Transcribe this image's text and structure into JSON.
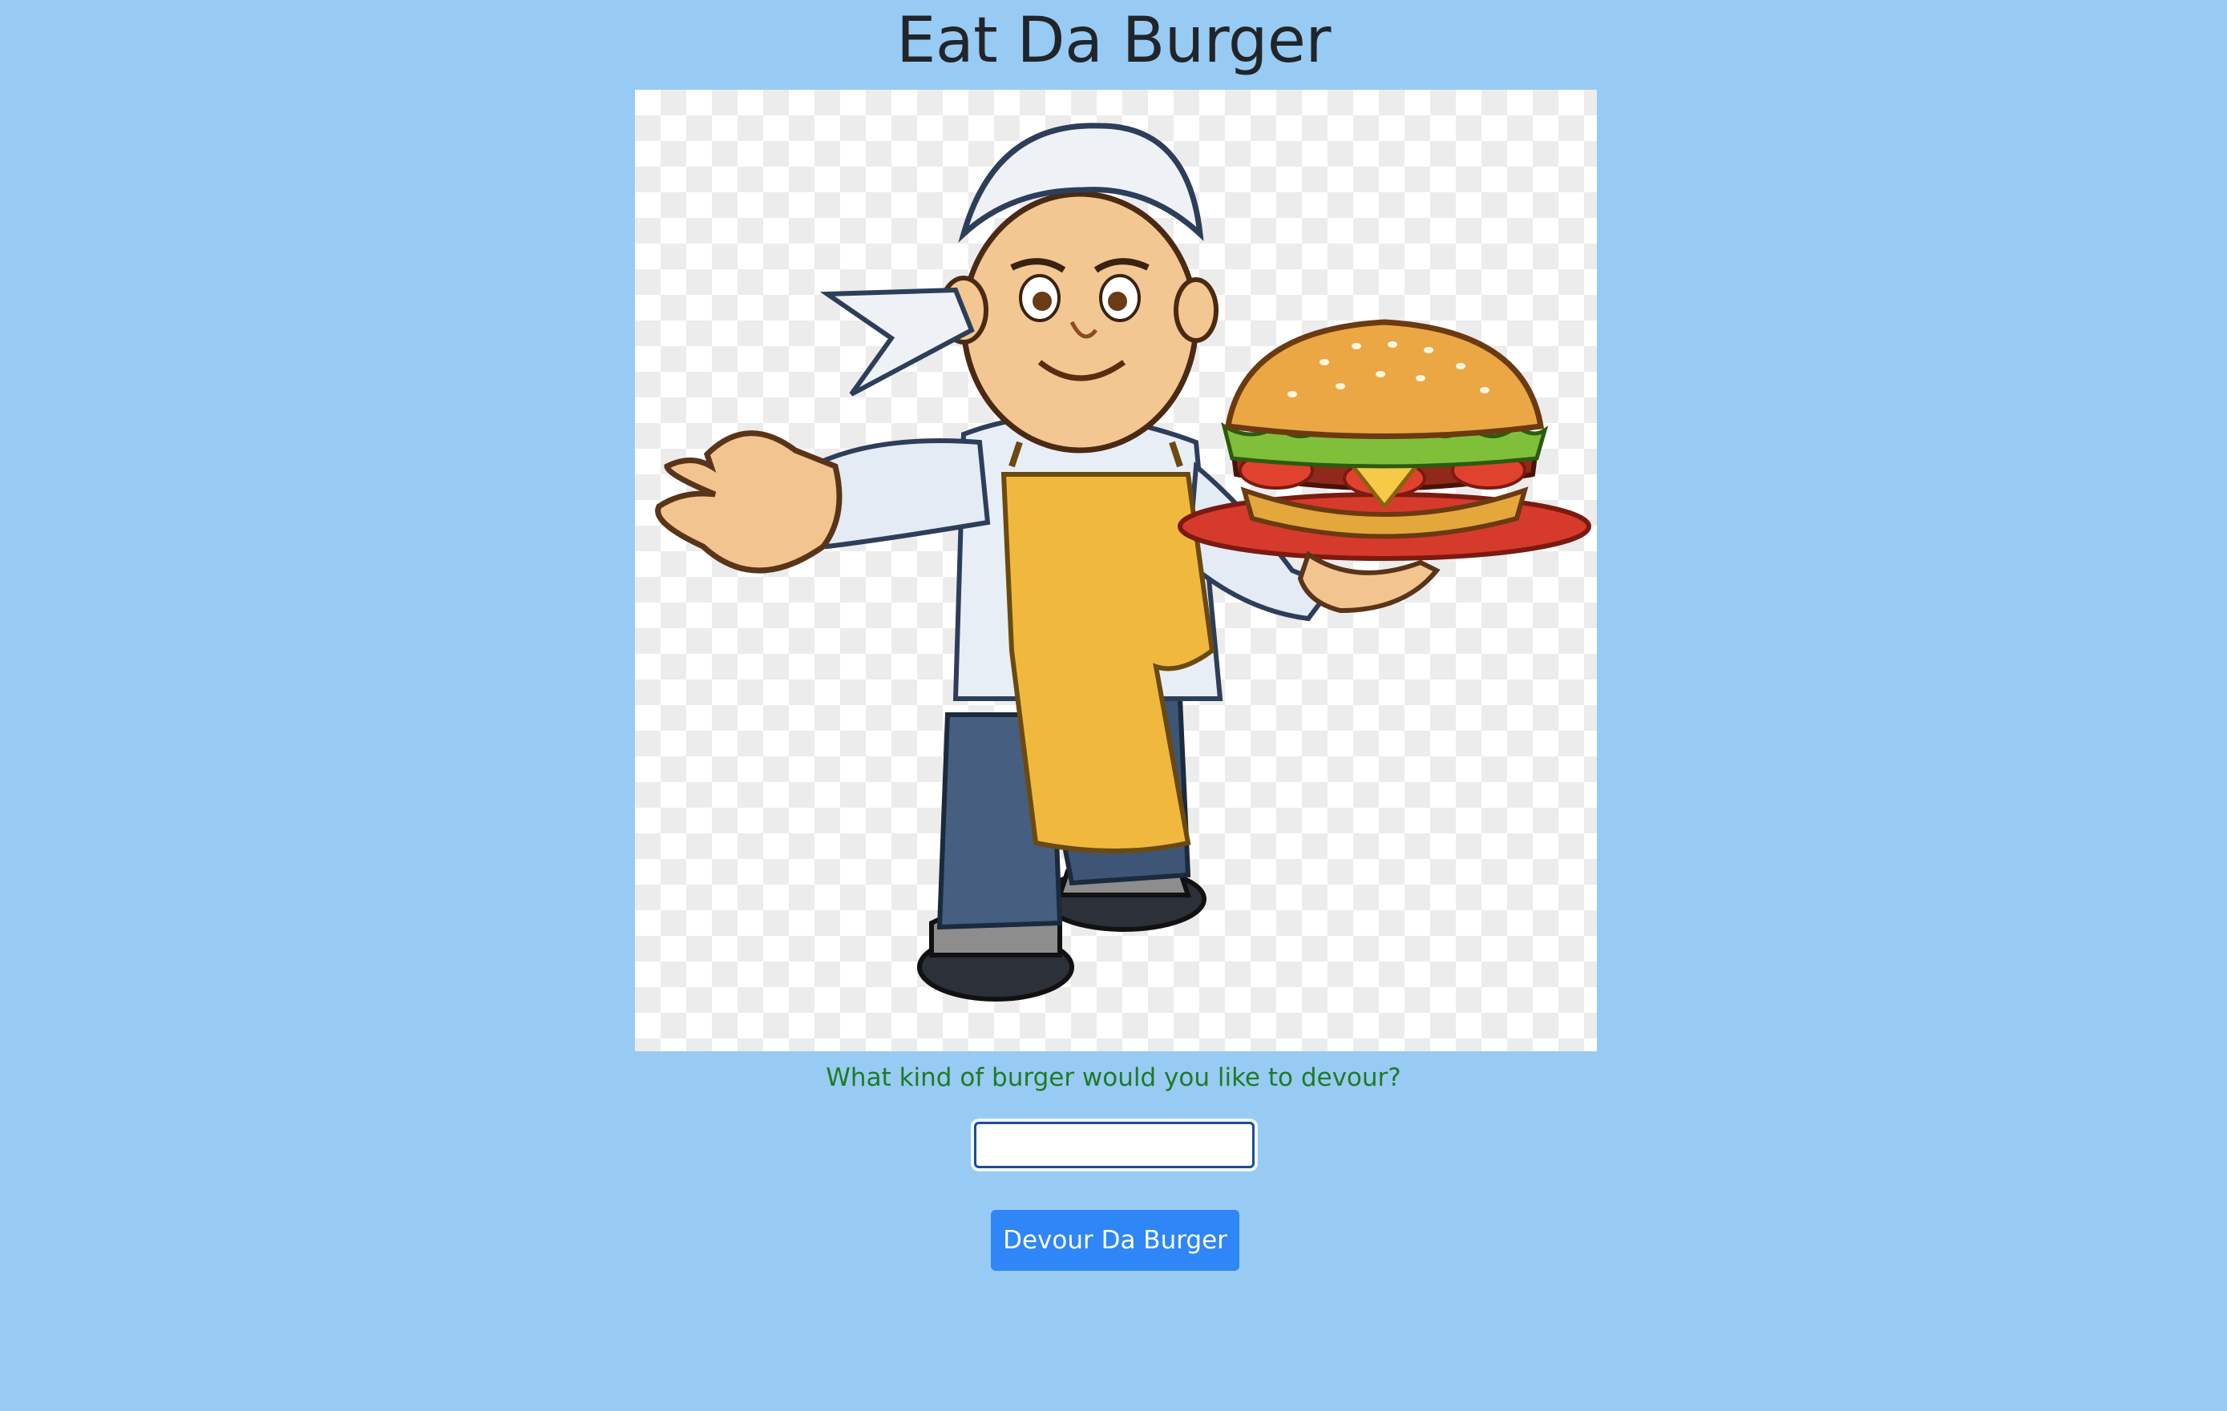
{
  "page": {
    "title": "Eat Da Burger",
    "background_color": "#97cbf4"
  },
  "hero_image": {
    "subject": "cartoon chef holding a cheeseburger on a red plate",
    "icon": "chef-burger-illustration"
  },
  "form": {
    "prompt_label": "What kind of burger would you like to devour?",
    "prompt_color": "#1f7a25",
    "input_value": "",
    "submit_label": "Devour Da Burger",
    "submit_color": "#2f86f6"
  }
}
